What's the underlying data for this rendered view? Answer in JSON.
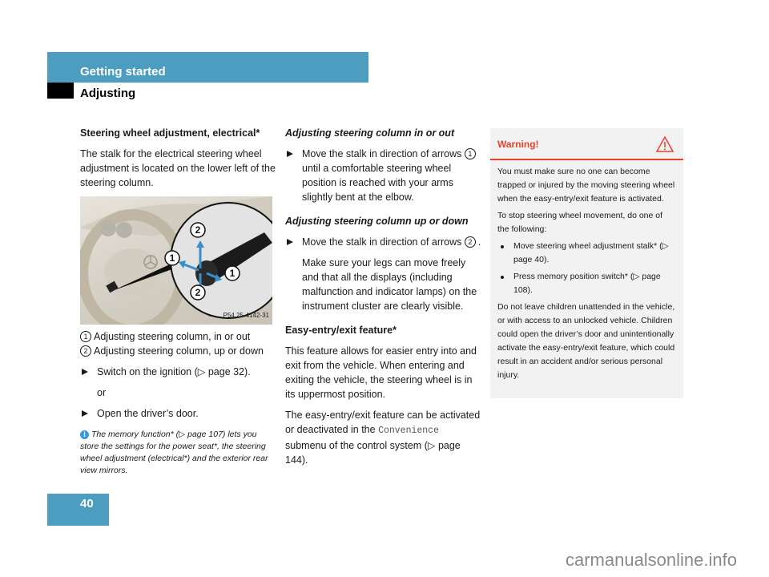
{
  "header": {
    "section": "Getting started",
    "subsection": "Adjusting"
  },
  "column1": {
    "heading": "Steering wheel adjustment, electrical*",
    "intro": "The stalk for the electrical steering wheel adjustment is located on the lower left of the steering column.",
    "figure": {
      "code": "P54.25-4142-31",
      "callouts": [
        "2",
        "1",
        "1",
        "2"
      ]
    },
    "legend": [
      {
        "num": "1",
        "text": "Adjusting steering column, in or out"
      },
      {
        "num": "2",
        "text": "Adjusting steering column, up or down"
      }
    ],
    "step1": "Switch on the ignition (▷ page 32).",
    "or": "or",
    "step2": "Open the driver’s door.",
    "info": "The memory function* (▷ page 107) lets you store the settings for the power seat*, the steering wheel adjustment (electrical*) and the exterior rear view mirrors."
  },
  "column2": {
    "heading_in_out": "Adjusting steering column in or out",
    "step_in_out_a": "Move the stalk in direction of arrows",
    "step_in_out_num": "1",
    "step_in_out_b": "until a comfortable steering wheel position is reached with your arms slightly bent at the elbow.",
    "heading_up_down": "Adjusting steering column up or down",
    "step_up_down_a": "Move the stalk in direction of arrows",
    "step_up_down_num": "2",
    "step_up_down_b": ".",
    "note_up_down": "Make sure your legs can move freely and that all the displays (including malfunction and indicator lamps) on the instrument cluster are clearly visible.",
    "heading_easy": "Easy-entry/exit feature*",
    "easy_p1": "This feature allows for easier entry into and exit from the vehicle. When entering and exiting the vehicle, the steering wheel is in its uppermost position.",
    "easy_p2_a": "The easy-entry/exit feature can be activated or deactivated in the",
    "easy_p2_menu": "Convenience",
    "easy_p2_b": "submenu of the control system (▷ page 144)."
  },
  "warning": {
    "title": "Warning!",
    "icon": "warning-triangle-icon",
    "p1": "You must make sure no one can become trapped or injured by the moving steering wheel when the easy-entry/exit feature is activated.",
    "p2": "To stop steering wheel movement, do one of the following:",
    "bullets": [
      "Move steering wheel adjustment stalk* (▷ page 40).",
      "Press memory position switch* (▷ page 108)."
    ],
    "p3": "Do not leave children unattended in the vehicle, or with access to an unlocked vehicle. Children could open the driver’s door and unintentionally activate the easy-entry/exit feature, which could result in an accident and/or serious personal injury."
  },
  "footer": {
    "page_number": "40",
    "watermark": "carmanualsonline.info"
  },
  "colors": {
    "accent_blue": "#4c9dc0",
    "warning_red": "#e8412c",
    "warning_bg": "#f2f2f2",
    "arrow_blue": "#3a8fc8"
  }
}
